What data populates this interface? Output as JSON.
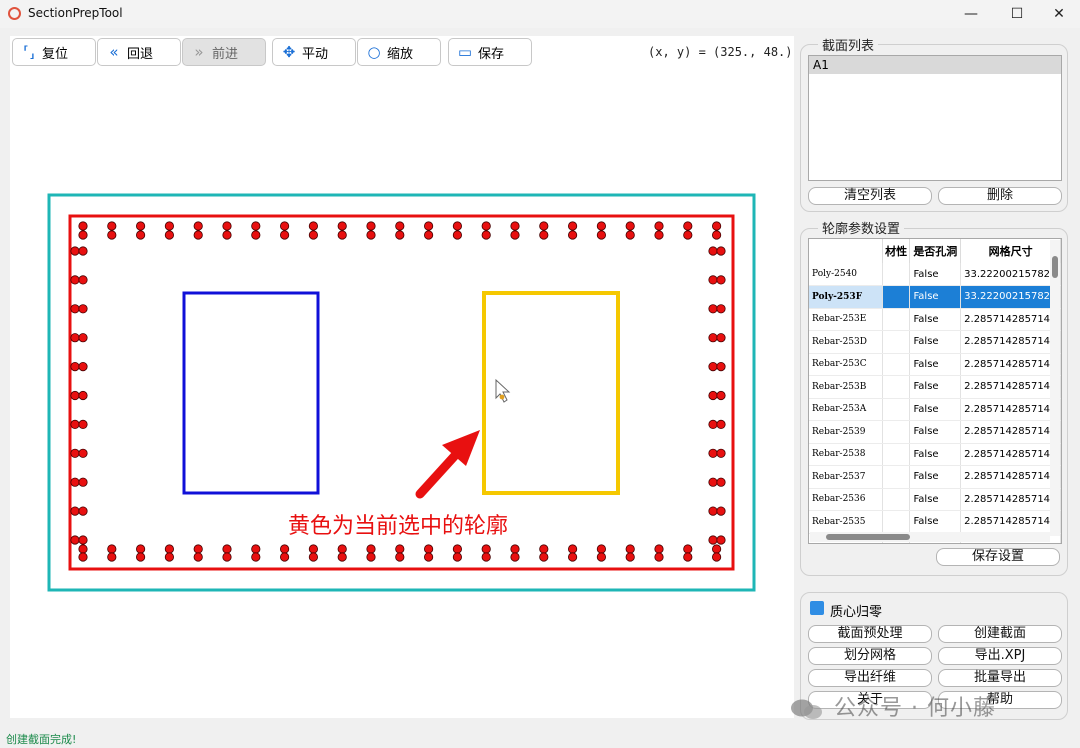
{
  "window": {
    "title": "SectionPrepTool",
    "controls": [
      "—",
      "☐",
      "✕"
    ]
  },
  "toolbar": {
    "buttons": [
      {
        "label": "复位",
        "icon": "⸢⸥"
      },
      {
        "label": "回退",
        "icon": "«"
      },
      {
        "label": "前进",
        "icon": "»"
      },
      {
        "label": "平动",
        "icon": "✥"
      },
      {
        "label": "缩放",
        "icon": "○"
      },
      {
        "label": "保存",
        "icon": "▭"
      }
    ],
    "coords": "(x, y) = (325., 48.)"
  },
  "canvas": {
    "annotation": "黄色为当前选中的轮廓",
    "colors": {
      "outer": "#1eb6b6",
      "rebar_box": "#e81010",
      "rebar_fill": "#e81010",
      "left_hole": "#1010d8",
      "selected": "#f5c800",
      "arrow": "#e81010"
    }
  },
  "section_list": {
    "title": "截面列表",
    "items": [
      "A1"
    ],
    "clear_label": "清空列表",
    "delete_label": "删除"
  },
  "contour_params": {
    "title": "轮廓参数设置",
    "columns": [
      "",
      "材性",
      "是否孔洞",
      "网格尺寸"
    ],
    "rows": [
      {
        "name": "Poly-2540",
        "material": "",
        "hole": "False",
        "mesh": "33.222002157820"
      },
      {
        "name": "Poly-253F",
        "material": "",
        "hole": "False",
        "mesh": "33.222002157820"
      },
      {
        "name": "Rebar-253E",
        "material": "",
        "hole": "False",
        "mesh": "2.2857142857142"
      },
      {
        "name": "Rebar-253D",
        "material": "",
        "hole": "False",
        "mesh": "2.2857142857142"
      },
      {
        "name": "Rebar-253C",
        "material": "",
        "hole": "False",
        "mesh": "2.2857142857142"
      },
      {
        "name": "Rebar-253B",
        "material": "",
        "hole": "False",
        "mesh": "2.2857142857142"
      },
      {
        "name": "Rebar-253A",
        "material": "",
        "hole": "False",
        "mesh": "2.2857142857142"
      },
      {
        "name": "Rebar-2539",
        "material": "",
        "hole": "False",
        "mesh": "2.2857142857142"
      },
      {
        "name": "Rebar-2538",
        "material": "",
        "hole": "False",
        "mesh": "2.2857142857142"
      },
      {
        "name": "Rebar-2537",
        "material": "",
        "hole": "False",
        "mesh": "2.2857142857142"
      },
      {
        "name": "Rebar-2536",
        "material": "",
        "hole": "False",
        "mesh": "2.2857142857142"
      },
      {
        "name": "Rebar-2535",
        "material": "",
        "hole": "False",
        "mesh": "2.2857142857142"
      },
      {
        "name": "",
        "material": "",
        "hole": "",
        "mesh": ""
      }
    ],
    "save_label": "保存设置"
  },
  "actions": {
    "centroid_label": "质心归零",
    "preprocess_label": "截面预处理",
    "create_label": "创建截面",
    "mesh_label": "划分网格",
    "export_xpj_label": "导出.XPJ",
    "export_fiber_label": "导出纤维",
    "batch_export_label": "批量导出",
    "about_label": "关于",
    "help_label": "帮助"
  },
  "status": {
    "text": "创建截面完成!"
  },
  "watermark": {
    "text": "公众号 · 何小藤"
  }
}
